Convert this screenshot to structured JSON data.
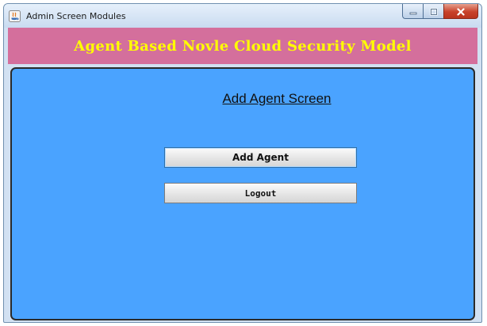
{
  "window": {
    "title": "Admin Screen Modules",
    "controls": [
      "minimize",
      "maximize",
      "close"
    ]
  },
  "banner": {
    "title": "Agent Based Novle Cloud Security Model"
  },
  "screen": {
    "title": "Add Agent Screen"
  },
  "buttons": {
    "add_agent": "Add Agent",
    "logout": "Logout"
  },
  "colors": {
    "banner_bg": "#d46f9c",
    "banner_text": "#ffff00",
    "panel_bg": "#4aa3ff",
    "close_button": "#c8422a"
  },
  "icons": {
    "app": "java-app-icon",
    "minimize": "minimize-icon",
    "maximize": "maximize-icon",
    "close": "close-icon"
  }
}
